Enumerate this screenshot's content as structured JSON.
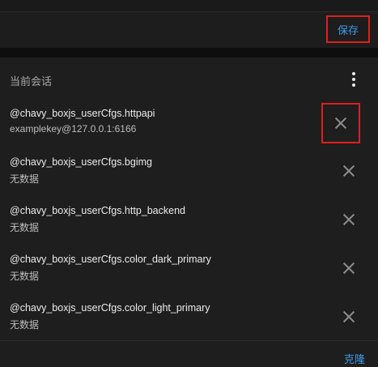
{
  "toolbar": {
    "save_label": "保存"
  },
  "session": {
    "title": "当前会话",
    "menu_icon": "more-vertical-icon",
    "items": [
      {
        "key": "@chavy_boxjs_userCfgs.httpapi",
        "value": "examplekey@127.0.0.1:6166",
        "highlighted": true
      },
      {
        "key": "@chavy_boxjs_userCfgs.bgimg",
        "value": "无数据",
        "highlighted": false
      },
      {
        "key": "@chavy_boxjs_userCfgs.http_backend",
        "value": "无数据",
        "highlighted": false
      },
      {
        "key": "@chavy_boxjs_userCfgs.color_dark_primary",
        "value": "无数据",
        "highlighted": false
      },
      {
        "key": "@chavy_boxjs_userCfgs.color_light_primary",
        "value": "无数据",
        "highlighted": false
      }
    ],
    "delete_icon": "close-icon",
    "clone_label": "克隆"
  },
  "colors": {
    "accent": "#3d9be9",
    "highlight": "#e01e1e",
    "background": "#121212",
    "card": "#1e1e1e"
  }
}
